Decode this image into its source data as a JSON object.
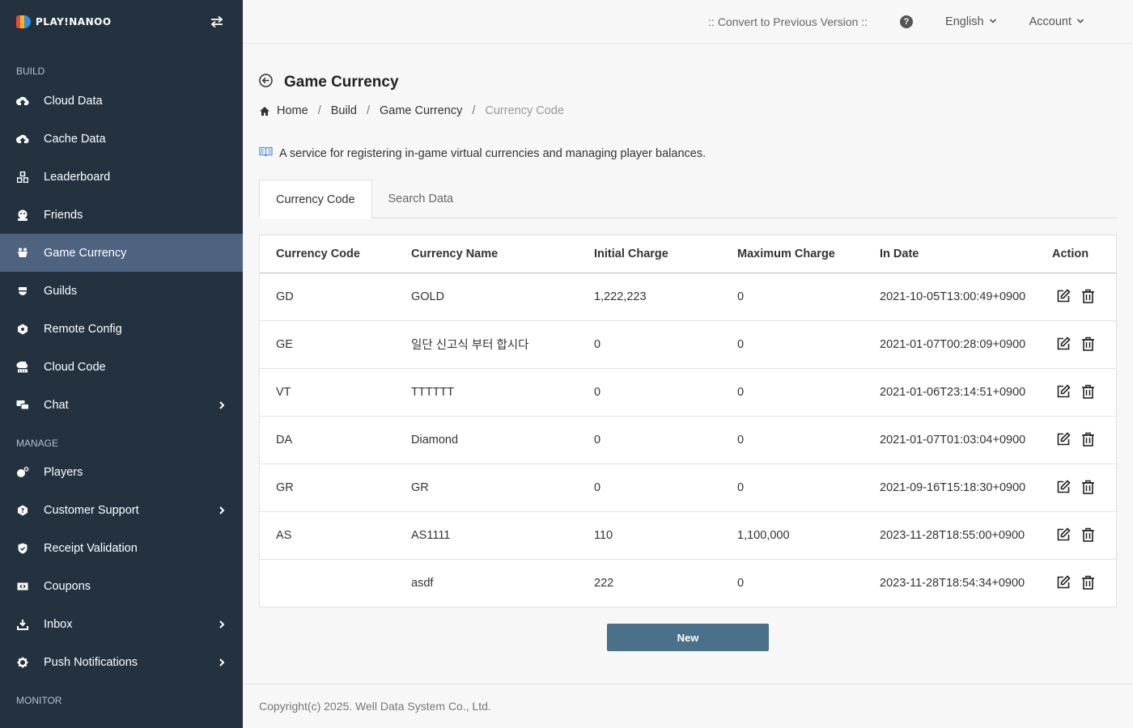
{
  "app": {
    "logo_text": "PLAY!NANOO"
  },
  "sidebar": {
    "sections": [
      {
        "label": "BUILD"
      },
      {
        "label": "MANAGE"
      },
      {
        "label": "MONITOR"
      }
    ],
    "items": [
      {
        "label": "Cloud Data",
        "icon": "cloud-upload-icon"
      },
      {
        "label": "Cache Data",
        "icon": "cloud-upload-icon"
      },
      {
        "label": "Leaderboard",
        "icon": "leaderboard-icon"
      },
      {
        "label": "Friends",
        "icon": "friends-icon"
      },
      {
        "label": "Game Currency",
        "icon": "currency-icon",
        "active": true
      },
      {
        "label": "Guilds",
        "icon": "guild-icon"
      },
      {
        "label": "Remote Config",
        "icon": "config-icon"
      },
      {
        "label": "Cloud Code",
        "icon": "cloud-code-icon"
      },
      {
        "label": "Chat",
        "icon": "chat-icon",
        "has_submenu": true
      },
      {
        "label": "Players",
        "icon": "players-icon"
      },
      {
        "label": "Customer Support",
        "icon": "support-icon",
        "has_submenu": true
      },
      {
        "label": "Receipt Validation",
        "icon": "shield-check-icon"
      },
      {
        "label": "Coupons",
        "icon": "coupon-icon"
      },
      {
        "label": "Inbox",
        "icon": "inbox-icon",
        "has_submenu": true
      },
      {
        "label": "Push Notifications",
        "icon": "gear-icon",
        "has_submenu": true
      }
    ]
  },
  "topbar": {
    "convert_link": ":: Convert to Previous Version ::",
    "help": "?",
    "language": "English",
    "account": "Account"
  },
  "page": {
    "title": "Game Currency",
    "breadcrumb": [
      "Home",
      "Build",
      "Game Currency",
      "Currency Code"
    ],
    "description": "A service for registering in-game virtual currencies and managing player balances."
  },
  "tabs": [
    {
      "label": "Currency Code",
      "active": true
    },
    {
      "label": "Search Data",
      "active": false
    }
  ],
  "table": {
    "headers": [
      "Currency Code",
      "Currency Name",
      "Initial Charge",
      "Maximum Charge",
      "In Date",
      "Action"
    ],
    "rows": [
      {
        "code": "GD",
        "name": "GOLD",
        "initial": "1,222,223",
        "max": "0",
        "date": "2021-10-05T13:00:49+0900"
      },
      {
        "code": "GE",
        "name": "일단 신고식 부터 합시다",
        "initial": "0",
        "max": "0",
        "date": "2021-01-07T00:28:09+0900"
      },
      {
        "code": "VT",
        "name": "TTTTTT",
        "initial": "0",
        "max": "0",
        "date": "2021-01-06T23:14:51+0900"
      },
      {
        "code": "DA",
        "name": "Diamond",
        "initial": "0",
        "max": "0",
        "date": "2021-01-07T01:03:04+0900"
      },
      {
        "code": "GR",
        "name": "GR",
        "initial": "0",
        "max": "0",
        "date": "2021-09-16T15:18:30+0900"
      },
      {
        "code": "AS",
        "name": "AS1111",
        "initial": "110",
        "max": "1,100,000",
        "date": "2023-11-28T18:55:00+0900"
      },
      {
        "code": "",
        "name": "asdf",
        "initial": "222",
        "max": "0",
        "date": "2023-11-28T18:54:34+0900"
      }
    ]
  },
  "buttons": {
    "new": "New"
  },
  "footer": {
    "copyright": "Copyright(c) 2025. Well Data System Co., Ltd."
  },
  "colors": {
    "sidebar_bg": "#243240",
    "active_item": "#4e6380",
    "primary_button": "#4b7089"
  }
}
